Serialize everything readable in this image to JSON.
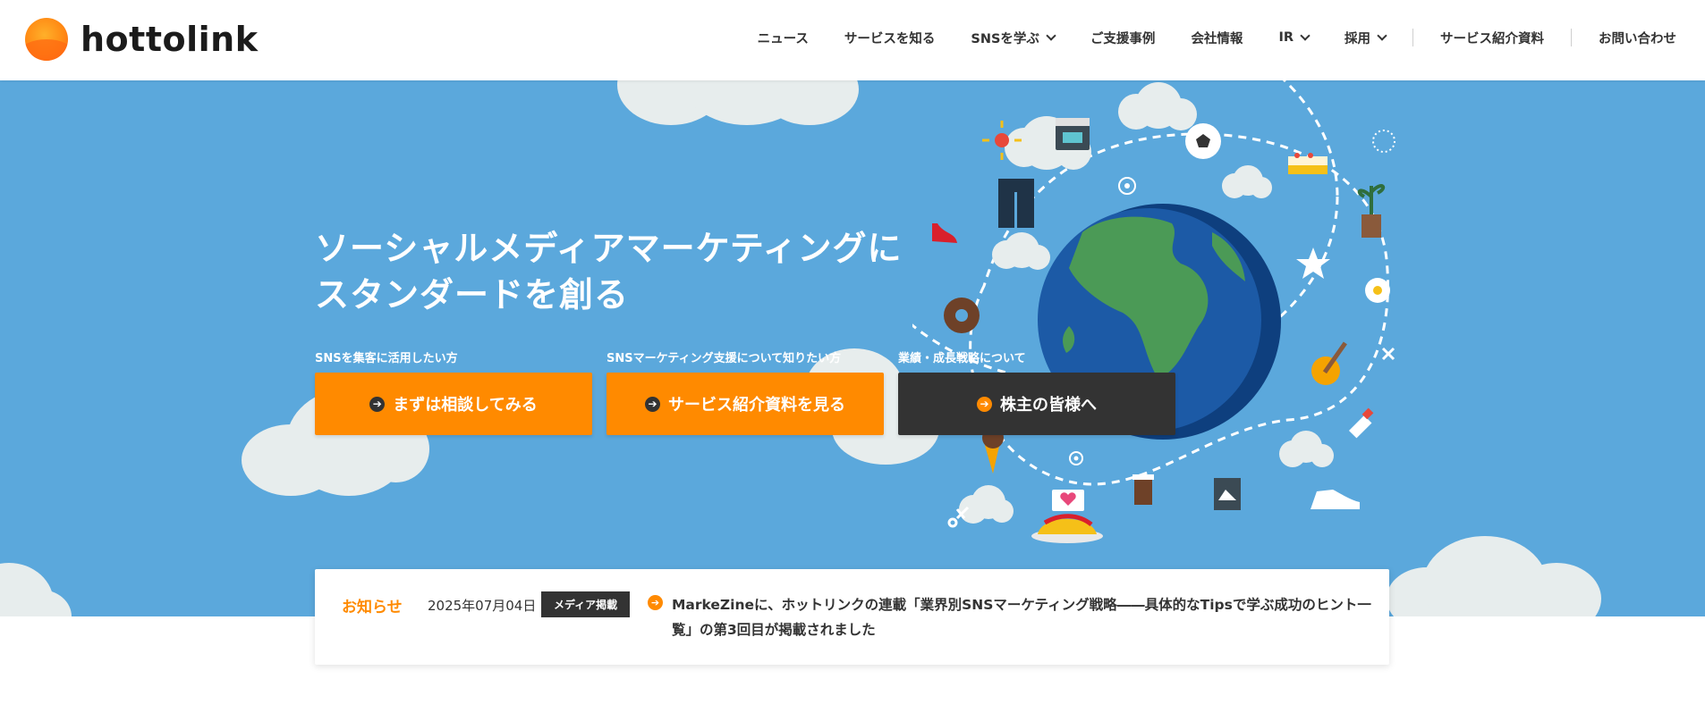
{
  "header": {
    "logo_text": "hottolink",
    "nav": [
      {
        "label": "ニュース",
        "has_dropdown": false
      },
      {
        "label": "サービスを知る",
        "has_dropdown": false
      },
      {
        "label": "SNSを学ぶ",
        "has_dropdown": true
      },
      {
        "label": "ご支援事例",
        "has_dropdown": false
      },
      {
        "label": "会社情報",
        "has_dropdown": false
      },
      {
        "label": "IR",
        "has_dropdown": true
      },
      {
        "label": "採用",
        "has_dropdown": true
      },
      {
        "label": "サービス紹介資料",
        "has_dropdown": false
      },
      {
        "label": "お問い合わせ",
        "has_dropdown": false
      }
    ]
  },
  "hero": {
    "title_line1": "ソーシャルメディアマーケティングに",
    "title_line2": "スタンダードを創る",
    "ctas": [
      {
        "label_above": "SNSを集客に活用したい方",
        "button": "まずは相談してみる",
        "style": "orange"
      },
      {
        "label_above": "SNSマーケティング支援について知りたい方",
        "button": "サービス紹介資料を見る",
        "style": "orange"
      },
      {
        "label_above": "業績・成長戦略について",
        "button": "株主の皆様へ",
        "style": "dark"
      }
    ]
  },
  "news": {
    "heading": "お知らせ",
    "date": "2025年07月04日",
    "badge": "メディア掲載",
    "text": "MarkeZineに、ホットリンクの連載「業界別SNSマーケティング戦略――具体的なTipsで学ぶ成功のヒント一覧」の第3回目が掲載されました"
  },
  "colors": {
    "accent": "#ff8a00",
    "hero_bg": "#5ba8dc",
    "dark_button": "#333333"
  }
}
